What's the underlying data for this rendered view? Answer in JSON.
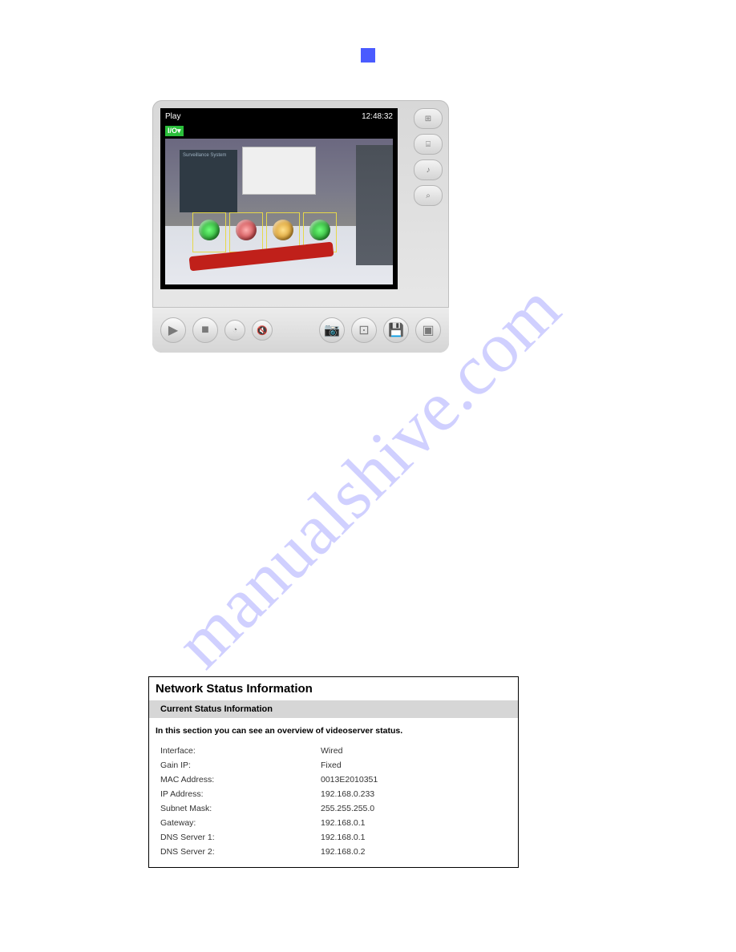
{
  "watermark": "manualshive.com",
  "player": {
    "status_label": "Play",
    "timestamp": "12:48:32",
    "io_badge": "I/O▾",
    "panel_text": "Surveillance\nSystem",
    "side_buttons": [
      {
        "name": "split-view-button",
        "glyph": "⊞"
      },
      {
        "name": "layout-button",
        "glyph": "⌸"
      },
      {
        "name": "audio-settings-button",
        "glyph": "♪"
      },
      {
        "name": "record-settings-button",
        "glyph": "⌕"
      }
    ],
    "controls": [
      {
        "name": "play-button",
        "glyph": "▶",
        "size": "lg"
      },
      {
        "name": "stop-button",
        "glyph": "■",
        "size": "lg"
      },
      {
        "name": "volume-button",
        "glyph": "◔",
        "size": "sm"
      },
      {
        "name": "mute-button",
        "glyph": "🔇",
        "size": "sm"
      }
    ],
    "right_controls": [
      {
        "name": "snapshot-button",
        "glyph": "📷"
      },
      {
        "name": "ptz-button",
        "glyph": "⊡"
      },
      {
        "name": "save-button",
        "glyph": "💾"
      },
      {
        "name": "fullscreen-button",
        "glyph": "▣"
      }
    ]
  },
  "network": {
    "title": "Network Status Information",
    "subtitle": "Current Status Information",
    "note": "In this section you can see an overview of videoserver status.",
    "rows": [
      {
        "k": "Interface:",
        "v": "Wired"
      },
      {
        "k": "Gain IP:",
        "v": "Fixed"
      },
      {
        "k": "MAC Address:",
        "v": "0013E2010351"
      },
      {
        "k": "IP Address:",
        "v": "192.168.0.233"
      },
      {
        "k": "Subnet Mask:",
        "v": "255.255.255.0"
      },
      {
        "k": "Gateway:",
        "v": "192.168.0.1"
      },
      {
        "k": "DNS Server 1:",
        "v": "192.168.0.1"
      },
      {
        "k": "DNS Server 2:",
        "v": "192.168.0.2"
      }
    ]
  }
}
